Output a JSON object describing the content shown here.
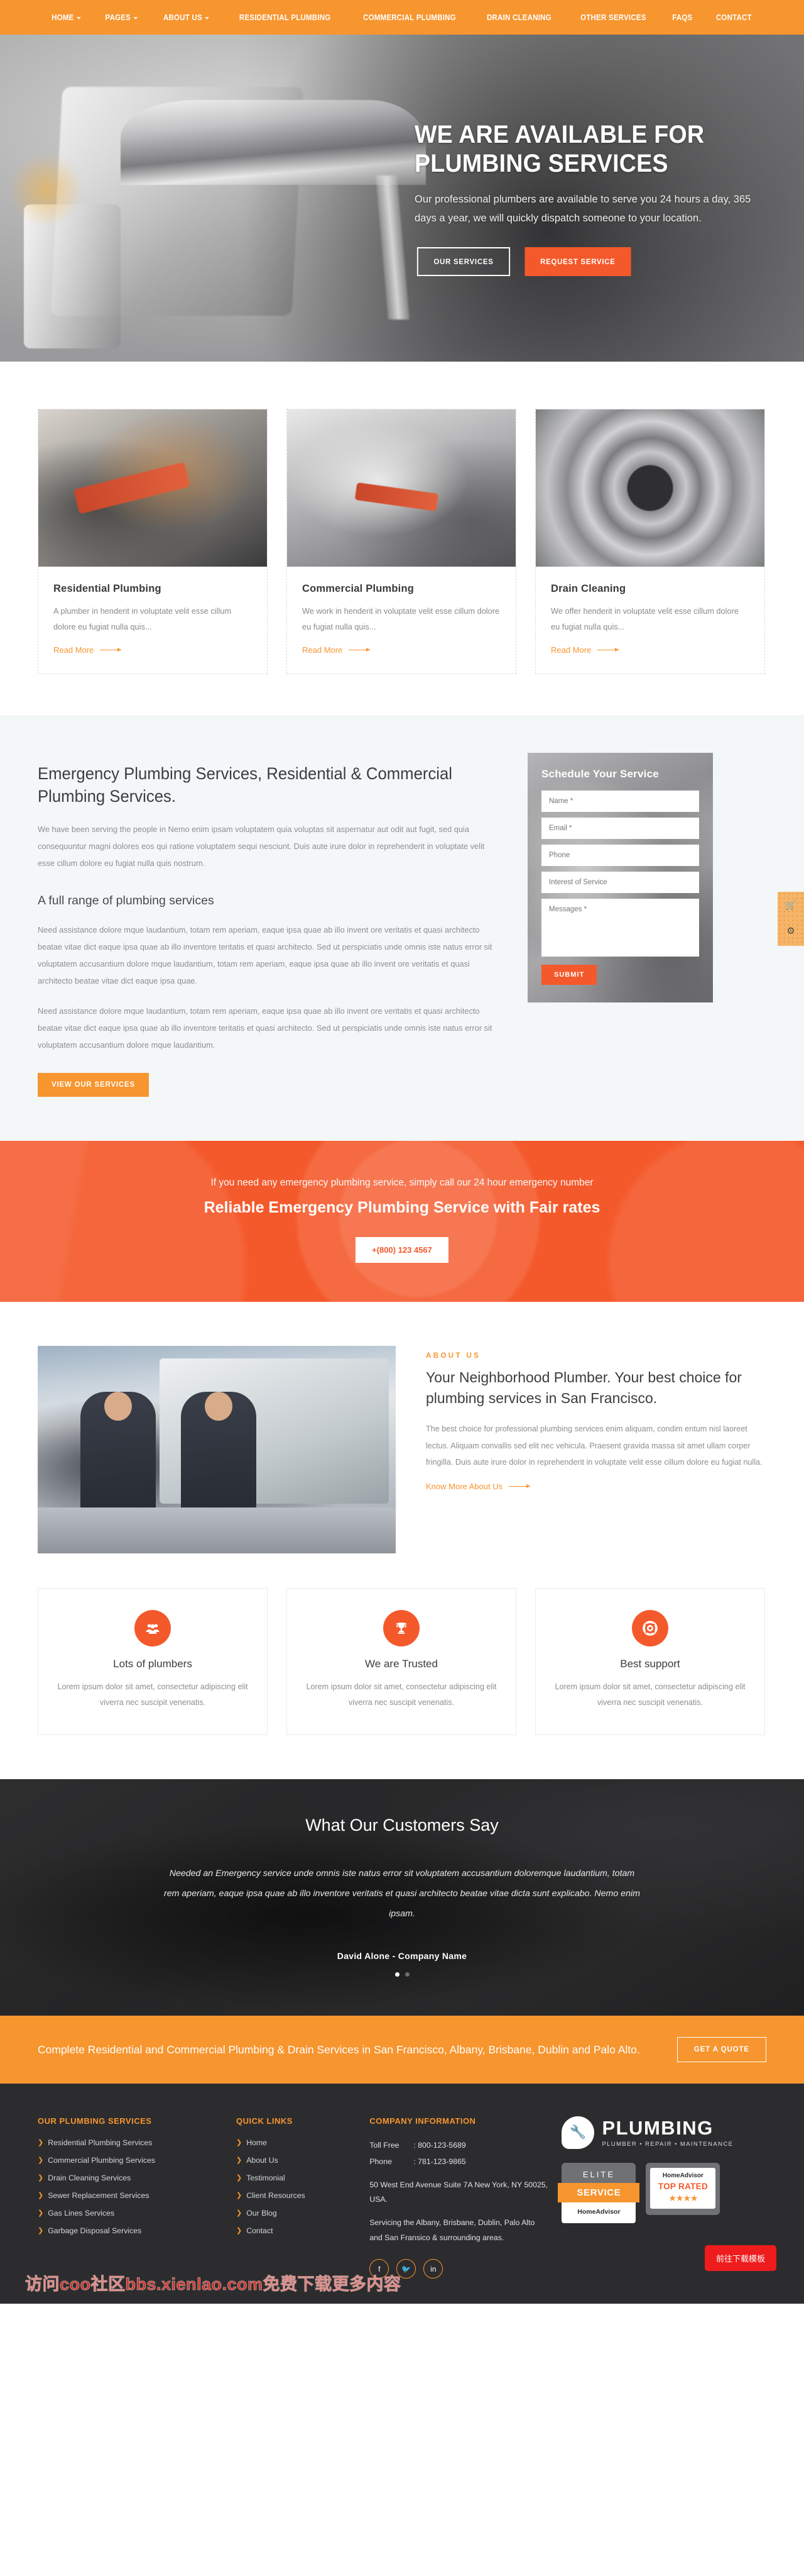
{
  "nav": {
    "items": [
      {
        "label": "HOME",
        "caret": true
      },
      {
        "label": "PAGES",
        "caret": true
      },
      {
        "label": "ABOUT US",
        "caret": true
      },
      {
        "label": "RESIDENTIAL PLUMBING",
        "caret": false
      },
      {
        "label": "COMMERCIAL PLUMBING",
        "caret": false
      },
      {
        "label": "DRAIN CLEANING",
        "caret": false
      },
      {
        "label": "OTHER SERVICES",
        "caret": false
      },
      {
        "label": "FAQS",
        "caret": false
      },
      {
        "label": "CONTACT",
        "caret": false
      }
    ]
  },
  "hero": {
    "title": "WE ARE AVAILABLE FOR PLUMBING SERVICES",
    "subtitle": "Our professional plumbers are available to serve you 24 hours a day, 365 days a year, we will quickly dispatch someone to your location.",
    "btn_primary": "OUR SERVICES",
    "btn_secondary": "REQUEST SERVICE"
  },
  "services": [
    {
      "title": "Residential Plumbing",
      "text": "A plumber in henderit in voluptate velit esse cillum dolore eu fugiat nulla quis...",
      "link": "Read More"
    },
    {
      "title": "Commercial Plumbing",
      "text": "We work in henderit in voluptate velit esse cillum dolore eu fugiat nulla quis...",
      "link": "Read More"
    },
    {
      "title": "Drain Cleaning",
      "text": "We offer henderit in voluptate velit esse cillum dolore eu fugiat nulla quis...",
      "link": "Read More"
    }
  ],
  "emergency": {
    "heading": "Emergency Plumbing Services, Residential & Commercial Plumbing Services.",
    "paragraph": "We have been serving the people in Nemo enim ipsam voluptatem quia voluptas sit aspernatur aut odit aut fugit, sed quia consequuntur magni dolores eos qui ratione voluptatem sequi nesciunt. Duis aute irure dolor in reprehenderit in voluptate velit esse cillum dolore eu fugiat nulla quis nostrum.",
    "subheading": "A full range of plumbing services",
    "paragraph2": "Need assistance dolore mque laudantium, totam rem aperiam, eaque ipsa quae ab illo invent ore veritatis et quasi architecto beatae vitae dict eaque ipsa quae ab illo inventore teritatis et quasi architecto. Sed ut perspiciatis unde omnis iste natus error sit voluptatem accusantium dolore mque laudantium, totam rem aperiam, eaque ipsa quae ab illo invent ore veritatis et quasi architecto beatae vitae dict eaque ipsa quae.",
    "paragraph3": "Need assistance dolore mque laudantium, totam rem aperiam, eaque ipsa quae ab illo invent ore veritatis et quasi architecto beatae vitae dict eaque ipsa quae ab illo inventore teritatis et quasi architecto. Sed ut perspiciatis unde omnis iste natus error sit voluptatem accusantium dolore mque laudantium.",
    "button": "VIEW OUR SERVICES"
  },
  "form": {
    "title": "Schedule Your Service",
    "name_placeholder": "Name *",
    "email_placeholder": "Email *",
    "phone_placeholder": "Phone",
    "interest_placeholder": "Interest of Service",
    "messages_placeholder": "Messages *",
    "submit": "SUBMIT"
  },
  "side_widget": {
    "cart_icon": "cart-icon",
    "gear_icon": "gear-icon"
  },
  "band": {
    "line1": "If you need any emergency plumbing service, simply call our 24 hour emergency number",
    "line2": "Reliable Emergency Plumbing Service with Fair rates",
    "phone": "+(800) 123 4567"
  },
  "about": {
    "eyebrow": "ABOUT US",
    "heading": "Your Neighborhood Plumber. Your best choice for plumbing services in San Francisco.",
    "paragraph": "The best choice for professional plumbing services enim aliquam, condim entum nisl laoreet lectus. Aliquam convallis sed elit nec vehicula. Praesent gravida massa sit amet ullam corper fringilla. Duis aute irure dolor in reprehenderit in voluptate velit esse cillum dolore eu fugiat nulla.",
    "link": "Know More About Us"
  },
  "features": [
    {
      "icon": "users-icon",
      "title": "Lots of plumbers",
      "text": "Lorem ipsum dolor sit amet, consectetur adipiscing elit viverra nec suscipit venenatis."
    },
    {
      "icon": "trophy-icon",
      "title": "We are Trusted",
      "text": "Lorem ipsum dolor sit amet, consectetur adipiscing elit viverra nec suscipit venenatis."
    },
    {
      "icon": "lifebuoy-icon",
      "title": "Best support",
      "text": "Lorem ipsum dolor sit amet, consectetur adipiscing elit viverra nec suscipit venenatis."
    }
  ],
  "testimonials": {
    "heading": "What Our Customers Say",
    "quote": "Needed an Emergency service unde omnis iste natus error sit voluptatem accusantium doloremque laudantium, totam rem aperiam, eaque ipsa quae ab illo inventore veritatis et quasi architecto beatae vitae dicta sunt explicabo. Nemo enim ipsam.",
    "author": "David Alone - Company Name",
    "dots": 2,
    "active_dot": 0
  },
  "cta": {
    "heading": "Complete Residential and Commercial Plumbing & Drain Services in San Francisco, Albany, Brisbane, Dublin and Palo Alto.",
    "button": "GET A QUOTE"
  },
  "footer": {
    "col1": {
      "heading": "OUR PLUMBING SERVICES",
      "links": [
        "Residential Plumbing Services",
        "Commercial Plumbing Services",
        "Drain Cleaning Services",
        "Sewer Replacement Services",
        "Gas Lines Services",
        "Garbage Disposal Services"
      ]
    },
    "col2": {
      "heading": "QUICK LINKS",
      "links": [
        "Home",
        "About Us",
        "Testimonial",
        "Client Resources",
        "Our Blog",
        "Contact"
      ]
    },
    "col3": {
      "heading": "COMPANY INFORMATION",
      "tollfree_label": "Toll Free",
      "tollfree_value": ": 800-123-5689",
      "phone_label": "Phone",
      "phone_value": ": 781-123-9865",
      "address": "50 West End Avenue Suite 7A New York, NY 50025, USA.",
      "servicing": "Servicing the Albany, Brisbane, Dublin, Palo Alto and San Fransico & surrounding areas.",
      "socials": [
        "facebook-icon",
        "twitter-icon",
        "linkedin-icon"
      ]
    },
    "brand": {
      "name": "PLUMBING",
      "tagline": "PLUMBER  •  REPAIR  •  MAINTENANCE",
      "badge_elite_top": "ELITE",
      "badge_elite_mid": "SERVICE",
      "badge_elite_bot": "HomeAdvisor",
      "badge_top_ha": "HomeAdvisor",
      "badge_top_text": "TOP RATED",
      "badge_stars": "★★★★"
    },
    "red_button": "前往下载模板",
    "watermark": "访问coo社区bbs.xienlao.com免费下载更多内容"
  }
}
